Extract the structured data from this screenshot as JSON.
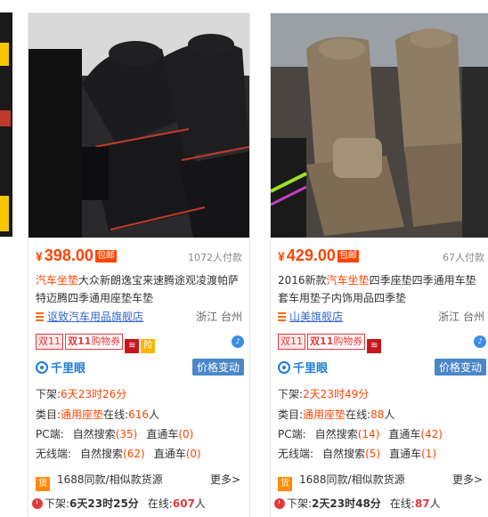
{
  "cards": [
    {
      "price": "398.00",
      "currency": "¥",
      "free_shipping": "包邮",
      "paid_count": "1072人付款",
      "title_keyword": "汽车坐垫",
      "title_rest": "大众新朗逸宝来速腾途观凌渡帕萨特迈腾四季通用座垫车垫",
      "shop_name": "讴致汽车用品旗舰店",
      "location": "浙江 台州",
      "badge_11": "双11",
      "badge_coupon_a": "双11",
      "badge_coupon_b": "购物券",
      "badge_extra": "险",
      "qianliyan": "千里眼",
      "price_change": "价格变动",
      "off_label": "下架:",
      "off_value": "6天23时26分",
      "category_label": "类目:",
      "category_value": "通用座垫",
      "online_label": "在线:",
      "online_value": "616",
      "online_unit": "人",
      "pc_label": "PC端:",
      "pc_natural": "自然搜索",
      "pc_natural_count": "(35)",
      "pc_ztc": "直通车",
      "pc_ztc_count": "(0)",
      "wx_label": "无线端:",
      "wx_natural": "自然搜索",
      "wx_natural_count": "(62)",
      "wx_ztc": "直通车",
      "wx_ztc_count": "(0)",
      "huo_icon": "货",
      "similar": "1688同款/相似款货源",
      "more": "更多>",
      "bottom_off_label": "下架:",
      "bottom_off_value": "6天23时25分",
      "bottom_online_label": "在线:",
      "bottom_online_value": "607",
      "bottom_online_unit": "人"
    },
    {
      "price": "429.00",
      "currency": "¥",
      "free_shipping": "包邮",
      "paid_count": "67人付款",
      "title_prefix": "2016新款",
      "title_keyword": "汽车坐垫",
      "title_rest": "四季座垫四季通用车垫套车用垫子内饰用品四季垫",
      "shop_name": "山美旗舰店",
      "location": "浙江 台州",
      "badge_11": "双11",
      "badge_coupon_a": "双11",
      "badge_coupon_b": "购物券",
      "qianliyan": "千里眼",
      "price_change": "价格变动",
      "off_label": "下架:",
      "off_value": "2天23时49分",
      "category_label": "类目:",
      "category_value": "通用座垫",
      "online_label": "在线:",
      "online_value": "88",
      "online_unit": "人",
      "pc_label": "PC端:",
      "pc_natural": "自然搜索",
      "pc_natural_count": "(14)",
      "pc_ztc": "直通车",
      "pc_ztc_count": "(42)",
      "wx_label": "无线端:",
      "wx_natural": "自然搜索",
      "wx_natural_count": "(5)",
      "wx_ztc": "直通车",
      "wx_ztc_count": "(1)",
      "huo_icon": "货",
      "similar": "1688同款/相似款货源",
      "more": "更多>",
      "bottom_off_label": "下架:",
      "bottom_off_value": "2天23时48分",
      "bottom_online_label": "在线:",
      "bottom_online_value": "87",
      "bottom_online_unit": "人"
    }
  ],
  "colors": {
    "price": "#ff4400",
    "link": "#3366cc",
    "accent_blue": "#1e7bd6",
    "badge_red": "#e4393c"
  }
}
